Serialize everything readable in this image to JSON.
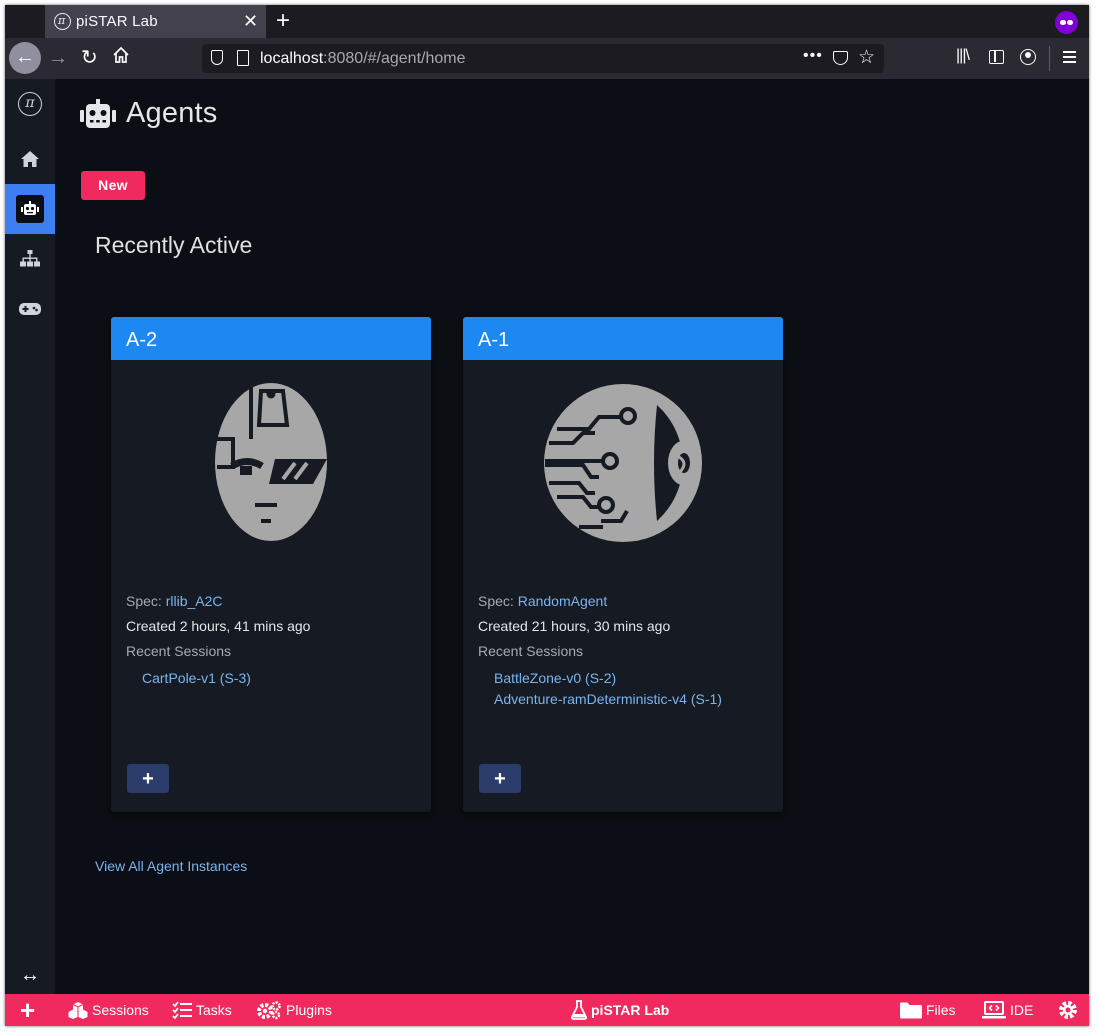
{
  "browser": {
    "tab_title": "piSTAR Lab",
    "tab_close": "✕",
    "new_tab": "+",
    "url_host": "localhost",
    "url_rest": ":8080/#/agent/home",
    "url_more": "•••"
  },
  "page": {
    "title": "Agents",
    "new_button": "New",
    "section_title": "Recently Active",
    "view_all_link": "View All Agent Instances"
  },
  "agents": [
    {
      "name": "A-2",
      "spec_label": "Spec: ",
      "spec_value": "rllib_A2C",
      "created": "Created 2 hours, 41 mins ago",
      "recent_sessions_label": "Recent Sessions",
      "sessions": [
        "CartPole-v1 (S-3)"
      ],
      "add_button": "+"
    },
    {
      "name": "A-1",
      "spec_label": "Spec: ",
      "spec_value": "RandomAgent",
      "created": "Created 21 hours, 30 mins ago",
      "recent_sessions_label": "Recent Sessions",
      "sessions": [
        "BattleZone-v0 (S-2)",
        "Adventure-ramDeterministic-v4 (S-1)"
      ],
      "add_button": "+"
    }
  ],
  "sidebar": {
    "logo": "π",
    "expand": "↔"
  },
  "bottom_bar": {
    "add": "+",
    "sessions": "Sessions",
    "tasks": "Tasks",
    "plugins": "Plugins",
    "brand": "piSTAR Lab",
    "files": "Files",
    "ide": "IDE"
  },
  "colors": {
    "accent": "#f0295f",
    "card_header": "#1e88f2",
    "sidebar_active": "#3d7ef0",
    "link": "#7ab4f0",
    "background": "#0b0e14"
  }
}
